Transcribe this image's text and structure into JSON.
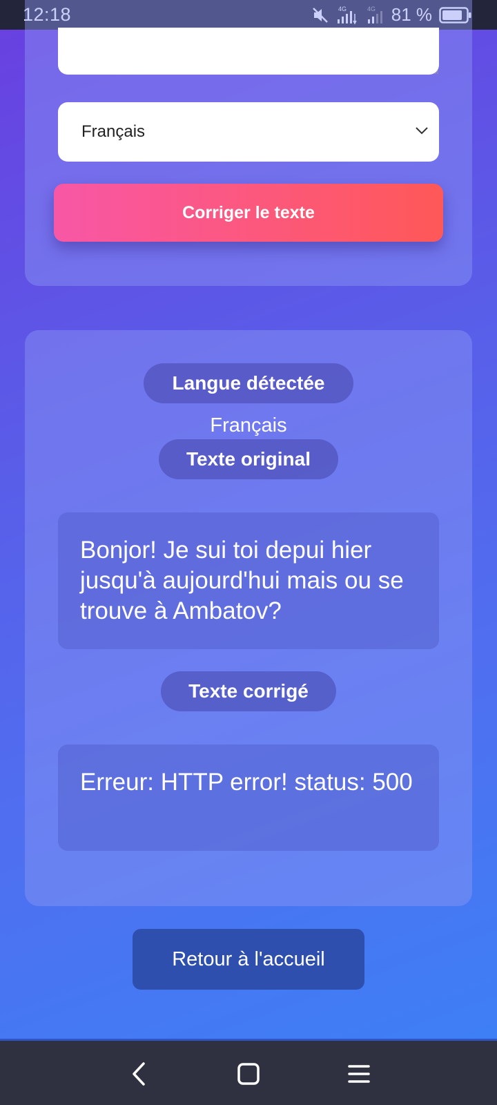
{
  "status_bar": {
    "time": "12:18",
    "battery_percent": "81 %",
    "icons": [
      "mute-icon",
      "signal-4g-icon",
      "signal-4g-icon",
      "battery-icon"
    ]
  },
  "form": {
    "language_select": {
      "selected": "Français"
    },
    "correct_button": "Corriger le texte"
  },
  "result": {
    "detected_language_label": "Langue détectée",
    "detected_language": "Français",
    "original_label": "Texte original",
    "original_text": "Bonjor! Je sui toi depui hier jusqu'à aujourd'hui mais ou se trouve à Ambatov?",
    "corrected_label": "Texte corrigé",
    "corrected_text": "Erreur: HTTP error! status: 500"
  },
  "back_button": "Retour à l'accueil",
  "nav_bar": {
    "icons": [
      "back-icon",
      "home-icon",
      "menu-icon"
    ]
  },
  "colors": {
    "accent_gradient_start": "#f857a6",
    "accent_gradient_end": "#ff5858",
    "back_button": "#2f4faf"
  }
}
